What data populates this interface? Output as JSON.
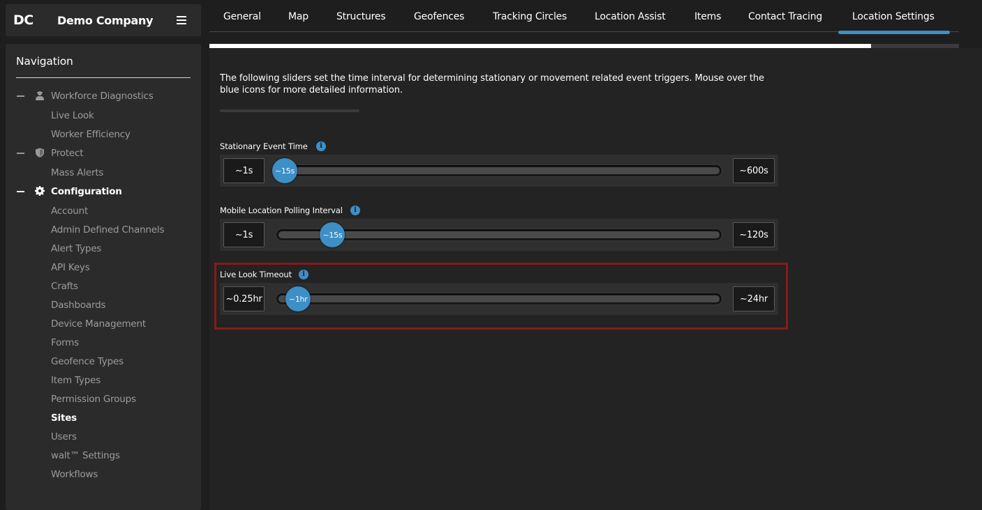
{
  "brand": {
    "logo": "DC",
    "name": "Demo Company"
  },
  "navigation": {
    "title": "Navigation",
    "items": [
      {
        "label": "Workforce Diagnostics",
        "type": "section",
        "icon": "worker-icon"
      },
      {
        "label": "Live Look",
        "type": "sub"
      },
      {
        "label": "Worker Efficiency",
        "type": "sub"
      },
      {
        "label": "Protect",
        "type": "section",
        "icon": "shield-icon"
      },
      {
        "label": "Mass Alerts",
        "type": "sub"
      },
      {
        "label": "Configuration",
        "type": "section",
        "icon": "gear-icon",
        "active": true
      },
      {
        "label": "Account",
        "type": "sub"
      },
      {
        "label": "Admin Defined Channels",
        "type": "sub"
      },
      {
        "label": "Alert Types",
        "type": "sub"
      },
      {
        "label": "API Keys",
        "type": "sub"
      },
      {
        "label": "Crafts",
        "type": "sub"
      },
      {
        "label": "Dashboards",
        "type": "sub"
      },
      {
        "label": "Device Management",
        "type": "sub"
      },
      {
        "label": "Forms",
        "type": "sub"
      },
      {
        "label": "Geofence Types",
        "type": "sub"
      },
      {
        "label": "Item Types",
        "type": "sub"
      },
      {
        "label": "Permission Groups",
        "type": "sub"
      },
      {
        "label": "Sites",
        "type": "sub",
        "active": true
      },
      {
        "label": "Users",
        "type": "sub"
      },
      {
        "label": "walt™ Settings",
        "type": "sub"
      },
      {
        "label": "Workflows",
        "type": "sub"
      }
    ]
  },
  "tabs": [
    {
      "label": "General"
    },
    {
      "label": "Map"
    },
    {
      "label": "Structures"
    },
    {
      "label": "Geofences"
    },
    {
      "label": "Tracking Circles"
    },
    {
      "label": "Location Assist"
    },
    {
      "label": "Items"
    },
    {
      "label": "Contact Tracing"
    },
    {
      "label": "Location Settings",
      "active": true
    }
  ],
  "progress": {
    "fraction": 0.883
  },
  "intro_text": "The following sliders set the time interval for determining stationary or movement related event triggers. Mouse over the blue icons for more detailed information.",
  "sliders": [
    {
      "label": "Stationary Event Time",
      "min_label": "~1s",
      "max_label": "~600s",
      "value_label": "~15s",
      "position_fraction": 0.0
    },
    {
      "label": "Mobile Location Polling Interval",
      "min_label": "~1s",
      "max_label": "~120s",
      "value_label": "~15s",
      "position_fraction": 0.114
    },
    {
      "label": "Live Look Timeout",
      "min_label": "~0.25hr",
      "max_label": "~24hr",
      "value_label": "~1hr",
      "position_fraction": 0.032,
      "highlighted": true
    }
  ],
  "colors": {
    "accent": "#3d8fc6",
    "highlight_border": "#8a1a1a",
    "background": "#1e1e1e",
    "panel": "#2b2b2b"
  },
  "icons": {
    "menu": "hamburger-icon",
    "info": "info-icon"
  }
}
